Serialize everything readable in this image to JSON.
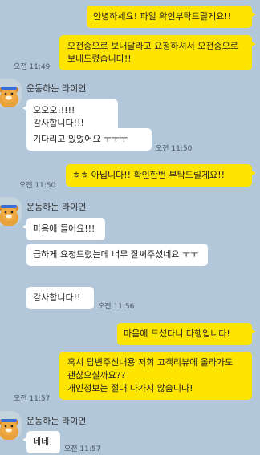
{
  "contact": {
    "name": "운동하는 라이언"
  },
  "messages": [
    {
      "text": "안녕하세요! 파일 확인부탁드릴게요!!"
    },
    {
      "text": "오전중으로 보내달라고 요청하셔서 오전중으로 보내드렸습니다!!",
      "time": "오전 11:49"
    },
    {
      "text": "오오오!!!!! 감사합니다!!!"
    },
    {
      "text": "기다리고 있었어요 ㅜㅜㅜ",
      "time": "오전 11:50"
    },
    {
      "text": "ㅎㅎ 아닙니다!! 확인한번 부탁드릴게요!!",
      "time": "오전 11:50"
    },
    {
      "text": "마음에 들어요!!!"
    },
    {
      "text": "급하게 요청드렸는데 너무 잘써주셨네요 ㅜㅜ"
    },
    {
      "text": "감사합니다!!",
      "time": "오전 11:56"
    },
    {
      "text": "마음에 드셨다니 다행입니다!"
    },
    {
      "text": "혹시 답변주신내용 저희 고객리뷰에 올라가도 괜찮으실까요??"
    },
    {
      "text": "개인정보는 절대 나가지 않습니다!",
      "time": "오전 11:57"
    },
    {
      "text": "네네!",
      "time": "오전 11:57"
    }
  ],
  "colors": {
    "background": "#b2c7d9",
    "my_bubble": "#fee500",
    "their_bubble": "#ffffff"
  }
}
